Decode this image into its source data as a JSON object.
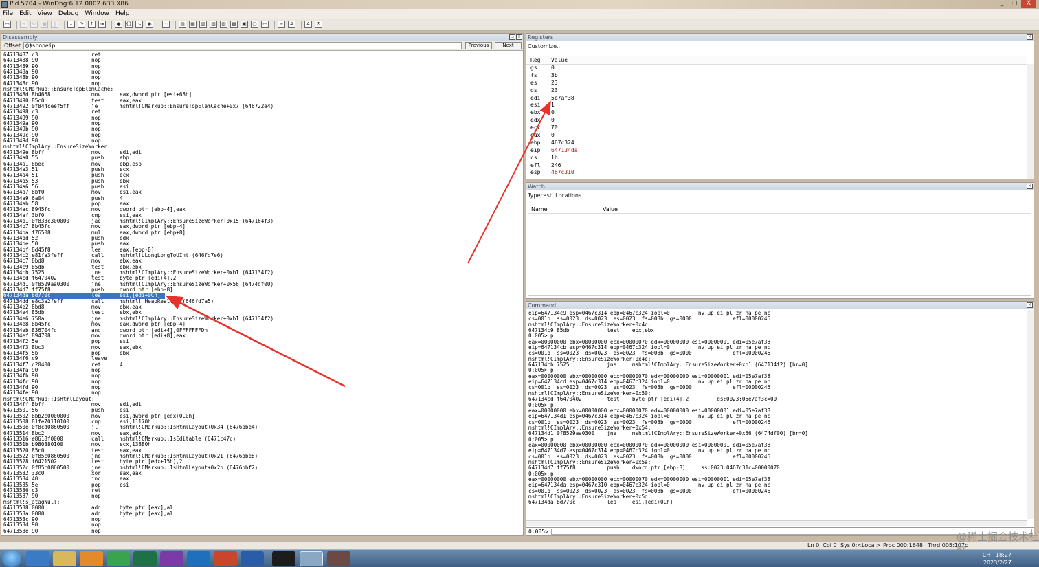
{
  "window": {
    "title": "Pid 5704 - WinDbg:6.12.0002.633 X86",
    "controls": [
      "_",
      "□",
      "X"
    ]
  },
  "menu": [
    "File",
    "Edit",
    "View",
    "Debug",
    "Window",
    "Help"
  ],
  "disassembly": {
    "title": "Disassembly",
    "offset_label": "Offset:",
    "offset_value": "@$scopeip",
    "previous_label": "Previous",
    "next_label": "Next",
    "lines": [
      [
        "64713487 c3",
        "ret",
        ""
      ],
      [
        "64713488 90",
        "nop",
        ""
      ],
      [
        "64713489 90",
        "nop",
        ""
      ],
      [
        "6471348a 90",
        "nop",
        ""
      ],
      [
        "6471348b 90",
        "nop",
        ""
      ],
      [
        "6471348c 90",
        "nop",
        ""
      ],
      [
        "mshtml!CMarkup::EnsureTopElemCache:",
        "",
        ""
      ],
      [
        "6471348d 8b4668",
        "mov",
        "eax,dword ptr [esi+68h]"
      ],
      [
        "64713490 85c0",
        "test",
        "eax,eax"
      ],
      [
        "64713492 0f844ceef5ff",
        "je",
        "mshtml!CMarkup::EnsureTopElemCache+0x7 (646722e4)"
      ],
      [
        "64713498 c3",
        "ret",
        ""
      ],
      [
        "64713499 90",
        "nop",
        ""
      ],
      [
        "6471349a 90",
        "nop",
        ""
      ],
      [
        "6471349b 90",
        "nop",
        ""
      ],
      [
        "6471349c 90",
        "nop",
        ""
      ],
      [
        "6471349d 90",
        "nop",
        ""
      ],
      [
        "mshtml!CImplAry::EnsureSizeWorker:",
        "",
        ""
      ],
      [
        "6471349e 8bff",
        "mov",
        "edi,edi"
      ],
      [
        "647134a0 55",
        "push",
        "ebp"
      ],
      [
        "647134a1 8bec",
        "mov",
        "ebp,esp"
      ],
      [
        "647134a3 51",
        "push",
        "ecx"
      ],
      [
        "647134a4 51",
        "push",
        "ecx"
      ],
      [
        "647134a5 53",
        "push",
        "ebx"
      ],
      [
        "647134a6 56",
        "push",
        "esi"
      ],
      [
        "647134a7 8bf0",
        "mov",
        "esi,eax"
      ],
      [
        "647134a9 6a04",
        "push",
        "4"
      ],
      [
        "647134ab 58",
        "pop",
        "eax"
      ],
      [
        "647134ac 8945fc",
        "mov",
        "dword ptr [ebp-4],eax"
      ],
      [
        "647134af 3bf0",
        "cmp",
        "esi,eax"
      ],
      [
        "647134b1 0f833c300000",
        "jae",
        "mshtml!CImplAry::EnsureSizeWorker+0x15 (647164f3)"
      ],
      [
        "647134b7 8b45fc",
        "mov",
        "eax,dword ptr [ebp-4]"
      ],
      [
        "647134ba f76508",
        "mul",
        "eax,dword ptr [ebp+8]"
      ],
      [
        "647134bd 52",
        "push",
        "edx"
      ],
      [
        "647134be 50",
        "push",
        "eax"
      ],
      [
        "647134bf 8d45f8",
        "lea",
        "eax,[ebp-8]"
      ],
      [
        "647134c2 e81fa3feff",
        "call",
        "mshtml!ULongLongToUInt (646fd7e6)"
      ],
      [
        "647134c7 8bd8",
        "mov",
        "ebx,eax"
      ],
      [
        "647134c9 85db",
        "test",
        "ebx,ebx"
      ],
      [
        "647134cb 7525",
        "jne",
        "mshtml!CImplAry::EnsureSizeWorker+0xb1 (647134f2)"
      ],
      [
        "647134cd f6470402",
        "test",
        "byte ptr [edi+4],2"
      ],
      [
        "647134d1 0f8529aa0300",
        "jne",
        "mshtml!CImplAry::EnsureSizeWorker+0x56 (6474df00)"
      ],
      [
        "647134d7 ff75f8",
        "push",
        "dword ptr [ebp-8]"
      ],
      [
        "647134da 8d770c",
        "lea",
        "esi,[edi+0Ch]"
      ],
      [
        "647134dd e8c3a2feff",
        "call",
        "mshtml!_HeapRealloc (646fd7a5)"
      ],
      [
        "647134e2 8bd8",
        "mov",
        "ebx,eax"
      ],
      [
        "647134e4 85db",
        "test",
        "ebx,ebx"
      ],
      [
        "647134e6 750a",
        "jne",
        "mshtml!CImplAry::EnsureSizeWorker+0xb1 (647134f2)"
      ],
      [
        "647134e8 8b45fc",
        "mov",
        "eax,dword ptr [ebp-4]"
      ],
      [
        "647134eb 836704fd",
        "and",
        "dword ptr [edi+4],0FFFFFFFDh"
      ],
      [
        "647134ef 894708",
        "mov",
        "dword ptr [edi+8],eax"
      ],
      [
        "647134f2 5e",
        "pop",
        "esi"
      ],
      [
        "647134f3 8bc3",
        "mov",
        "eax,ebx"
      ],
      [
        "647134f5 5b",
        "pop",
        "ebx"
      ],
      [
        "647134f6 c9",
        "leave",
        ""
      ],
      [
        "647134f7 c20400",
        "ret",
        "4"
      ],
      [
        "647134fa 90",
        "nop",
        ""
      ],
      [
        "647134fb 90",
        "nop",
        ""
      ],
      [
        "647134fc 90",
        "nop",
        ""
      ],
      [
        "647134fd 90",
        "nop",
        ""
      ],
      [
        "647134fe 90",
        "nop",
        ""
      ],
      [
        "mshtml!CMarkup::IsHtmlLayout:",
        "",
        ""
      ],
      [
        "647134ff 8bff",
        "mov",
        "edi,edi"
      ],
      [
        "64713501 56",
        "push",
        "esi"
      ],
      [
        "64713502 8bb2c0000000",
        "mov",
        "esi,dword ptr [edx+0C0h]"
      ],
      [
        "64713508 81fe70110100",
        "cmp",
        "esi,11170h"
      ],
      [
        "6471350e 0f8cd0860500",
        "jl",
        "mshtml!CMarkup::IsHtmlLayout+0x34 (6476bbe4)"
      ],
      [
        "64713514 8bc2",
        "mov",
        "eax,edx"
      ],
      [
        "64713516 e8618f0000",
        "call",
        "mshtml!CMarkup::IsEditable (6471c47c)"
      ],
      [
        "6471351b b980380100",
        "mov",
        "ecx,13880h"
      ],
      [
        "64713520 85c0",
        "test",
        "eax,eax"
      ],
      [
        "64713522 0f85c0860500",
        "jne",
        "mshtml!CMarkup::IsHtmlLayout+0x21 (6476bbe8)"
      ],
      [
        "64713528 f6421502",
        "test",
        "byte ptr [edx+15h],2"
      ],
      [
        "6471352c 0f85c0860500",
        "jne",
        "mshtml!CMarkup::IsHtmlLayout+0x2b (6476bbf2)"
      ],
      [
        "64713532 33c0",
        "xor",
        "eax,eax"
      ],
      [
        "64713534 40",
        "inc",
        "eax"
      ],
      [
        "64713535 5e",
        "pop",
        "esi"
      ],
      [
        "64713536 c3",
        "ret",
        ""
      ],
      [
        "64713537 90",
        "nop",
        ""
      ],
      [
        "mshtml!s_atagNull:",
        "",
        ""
      ],
      [
        "64713538 0000",
        "add",
        "byte ptr [eax],al"
      ],
      [
        "6471353a 0000",
        "add",
        "byte ptr [eax],al"
      ],
      [
        "6471353c 90",
        "nop",
        ""
      ],
      [
        "6471353d 90",
        "nop",
        ""
      ],
      [
        "6471353e 90",
        "nop",
        ""
      ]
    ],
    "highlighted_index": 42
  },
  "registers": {
    "title": "Registers",
    "customize": "Customize...",
    "col_reg": "Reg",
    "col_value": "Value",
    "rows": [
      [
        "gs",
        "0",
        false
      ],
      [
        "fs",
        "3b",
        false
      ],
      [
        "es",
        "23",
        false
      ],
      [
        "ds",
        "23",
        false
      ],
      [
        "edi",
        "5e7af38",
        false
      ],
      [
        "esi",
        "1",
        false
      ],
      [
        "ebx",
        "0",
        false
      ],
      [
        "edx",
        "0",
        false
      ],
      [
        "ecx",
        "70",
        false
      ],
      [
        "eax",
        "0",
        false
      ],
      [
        "ebp",
        "467c324",
        false
      ],
      [
        "eip",
        "647134da",
        true
      ],
      [
        "cs",
        "1b",
        false
      ],
      [
        "efl",
        "246",
        false
      ],
      [
        "esp",
        "467c310",
        true
      ]
    ]
  },
  "watch": {
    "title": "Watch",
    "typecast": "Typecast",
    "locations": "Locations",
    "col_name": "Name",
    "col_value": "Value"
  },
  "command": {
    "title": "Command",
    "prompt": "0:005>",
    "lines": [
      "eip=647134c9 esp=0467c314 ebp=0467c324 iopl=0         nv up ei pl zr na pe nc",
      "cs=001b  ss=0023  ds=0023  es=0023  fs=003b  gs=0000             efl=00000246",
      "mshtml!CImplAry::EnsureSizeWorker+0x4c:",
      "647134c9 85db            test    ebx,ebx",
      "0:005> p",
      "eax=00000000 ebx=00000000 ecx=00000070 edx=00000000 esi=00000001 edi=05e7af38",
      "eip=647134cb esp=0467c314 ebp=0467c324 iopl=0         nv up ei pl zr na pe nc",
      "cs=001b  ss=0023  ds=0023  es=0023  fs=003b  gs=0000             efl=00000246",
      "mshtml!CImplAry::EnsureSizeWorker+0x4e:",
      "647134cb 7525            jne     mshtml!CImplAry::EnsureSizeWorker+0xb1 (647134f2) [br=0]",
      "0:005> p",
      "eax=00000000 ebx=00000000 ecx=00000070 edx=00000000 esi=00000001 edi=05e7af38",
      "eip=647134cd esp=0467c314 ebp=0467c324 iopl=0         nv up ei pl zr na pe nc",
      "cs=001b  ss=0023  ds=0023  es=0023  fs=003b  gs=0000             efl=00000246",
      "mshtml!CImplAry::EnsureSizeWorker+0x50:",
      "647134cd f6470402        test    byte ptr [edi+4],2         ds:0023:05e7af3c=00",
      "0:005> p",
      "eax=00000000 ebx=00000000 ecx=00000070 edx=00000000 esi=00000001 edi=05e7af38",
      "eip=647134d1 esp=0467c314 ebp=0467c324 iopl=0         nv up ei pl zr na pe nc",
      "cs=001b  ss=0023  ds=0023  es=0023  fs=003b  gs=0000             efl=00000246",
      "mshtml!CImplAry::EnsureSizeWorker+0x54:",
      "647134d1 0f8529aa0300    jne     mshtml!CImplAry::EnsureSizeWorker+0x56 (6474df00) [br=0]",
      "0:005> p",
      "eax=00000000 ebx=00000000 ecx=00000070 edx=00000000 esi=00000001 edi=05e7af38",
      "eip=647134d7 esp=0467c314 ebp=0467c324 iopl=0         nv up ei pl zr na pe nc",
      "cs=001b  ss=0023  ds=0023  es=0023  fs=003b  gs=0000             efl=00000246",
      "mshtml!CImplAry::EnsureSizeWorker+0x5a:",
      "647134d7 ff75f8          push    dword ptr [ebp-8]     ss:0023:0467c31c=00000070",
      "0:005> p",
      "eax=00000000 ebx=00000000 ecx=00000070 edx=00000000 esi=00000001 edi=05e7af38",
      "eip=647134da esp=0467c310 ebp=0467c324 iopl=0         nv up ei pl zr na pe nc",
      "cs=001b  ss=0023  ds=0023  es=0023  fs=003b  gs=0000             efl=00000246",
      "mshtml!CImplAry::EnsureSizeWorker+0x5d:",
      "647134da 8d770c          lea     esi,[edi+0Ch]"
    ]
  },
  "status": {
    "pos": "Ln 0, Col 0",
    "sys": "Sys 0:<Local>",
    "proc": "Proc 000:1648",
    "thrd": "Thrd 005:107c"
  },
  "tray": {
    "time": "18:27",
    "date": "2023/2/27",
    "lang": "CH"
  },
  "watermark": "@稀土掘金技术社区",
  "colors": {
    "highlight": "#3a75c4",
    "arrow": "#e8312a",
    "reg_changed": "#c11111"
  }
}
